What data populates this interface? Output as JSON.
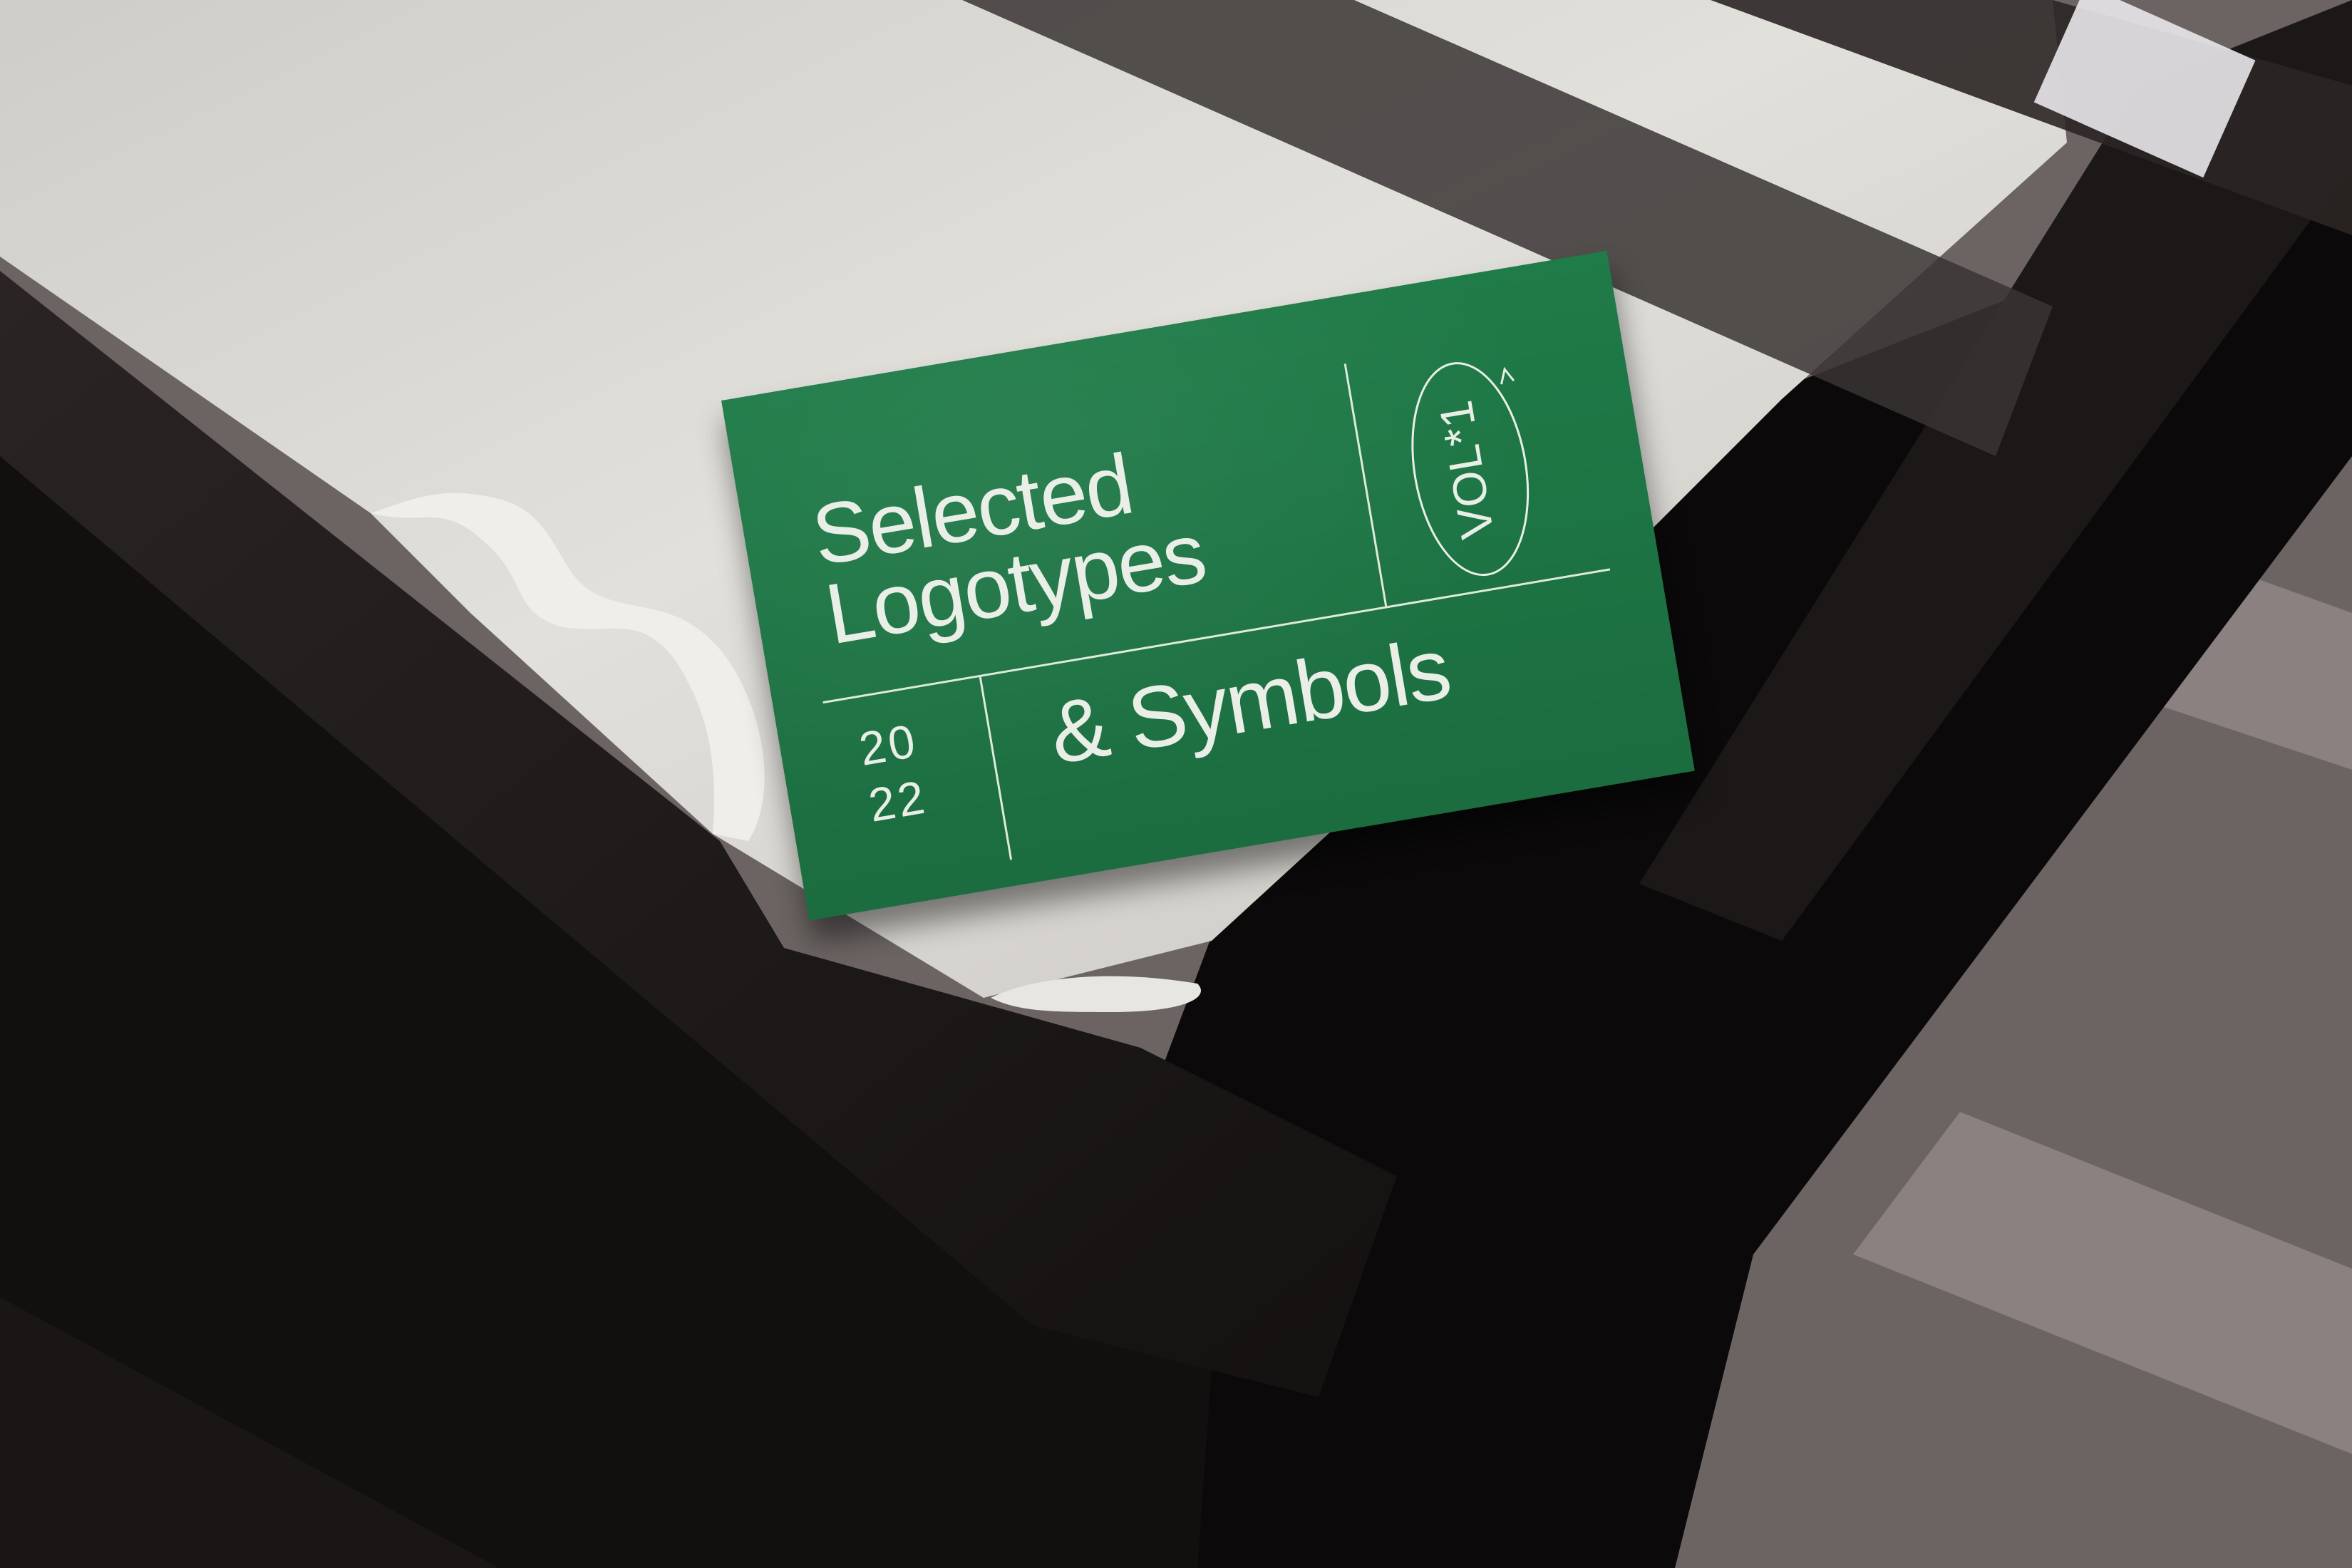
{
  "card": {
    "title_line1": "Selected",
    "title_line2": "Logotypes",
    "title_line3": "& Symbols",
    "year_top": "20",
    "year_bottom": "22",
    "volume": "VOL*1"
  },
  "colors": {
    "card_green": "#1f7b48",
    "print_white": "#e9efe6",
    "plaster_white": "#dcdad5",
    "shadow_dark": "#0d0b0b",
    "floor": "#6f6867"
  }
}
